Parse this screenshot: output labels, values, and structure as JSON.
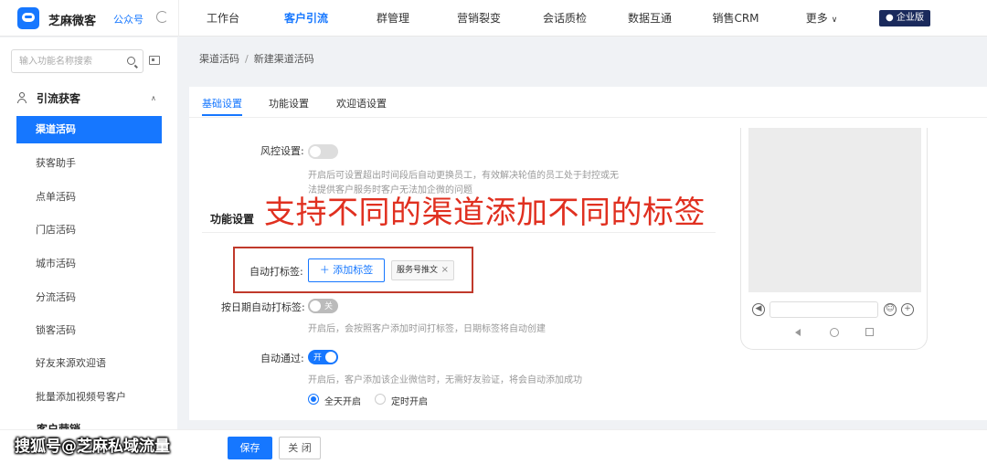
{
  "topbar": {
    "brand": "芝麻微客",
    "account_type": "公众号",
    "nav": [
      {
        "label": "工作台"
      },
      {
        "label": "客户引流",
        "active": true
      },
      {
        "label": "群管理"
      },
      {
        "label": "营销裂变"
      },
      {
        "label": "会话质检"
      },
      {
        "label": "数据互通"
      },
      {
        "label": "销售CRM"
      },
      {
        "label": "更多"
      }
    ],
    "edition": "企业版"
  },
  "sidebar": {
    "search_placeholder": "输入功能名称搜索",
    "group_title": "引流获客",
    "items": [
      {
        "label": "渠道活码",
        "active": true
      },
      {
        "label": "获客助手"
      },
      {
        "label": "点单活码"
      },
      {
        "label": "门店活码"
      },
      {
        "label": "城市活码"
      },
      {
        "label": "分流活码"
      },
      {
        "label": "锁客活码"
      },
      {
        "label": "好友来源欢迎语"
      },
      {
        "label": "批量添加视频号客户"
      }
    ],
    "next_group_title": "客户营销"
  },
  "breadcrumb": {
    "parent": "渠道活码",
    "separator": "/",
    "current": "新建渠道活码"
  },
  "tabs": [
    {
      "label": "基础设置",
      "active": true
    },
    {
      "label": "功能设置"
    },
    {
      "label": "欢迎语设置"
    }
  ],
  "form": {
    "risk_label": "风控设置:",
    "risk_help_1": "开启后可设置超出时间段后自动更换员工，有效解决轮值的员工处于封控或无",
    "risk_help_2": "法提供客户服务时客户无法加企微的问题",
    "section_title": "功能设置",
    "auto_tag_label": "自动打标签:",
    "add_tag_label": "添加标签",
    "tag_chip": "服务号推文",
    "date_tag_label": "按日期自动打标签:",
    "date_tag_switch": "关",
    "date_tag_help": "开启后，会按照客户添加时间打标签，日期标签将自动创建",
    "auto_pass_label": "自动通过:",
    "auto_pass_switch": "开",
    "auto_pass_help": "开启后，客户添加该企业微信时，无需好友验证，将会自动添加成功",
    "radio_all_day": "全天开启",
    "radio_timed": "定时开启"
  },
  "annotation": "支持不同的渠道添加不同的标签",
  "footer": {
    "save": "保存",
    "close": "关 闭"
  },
  "watermark": "搜狐号@芝麻私域流量",
  "colors": {
    "primary": "#1677ff",
    "annotation": "#e03020",
    "highlight_box": "#c0392b"
  }
}
